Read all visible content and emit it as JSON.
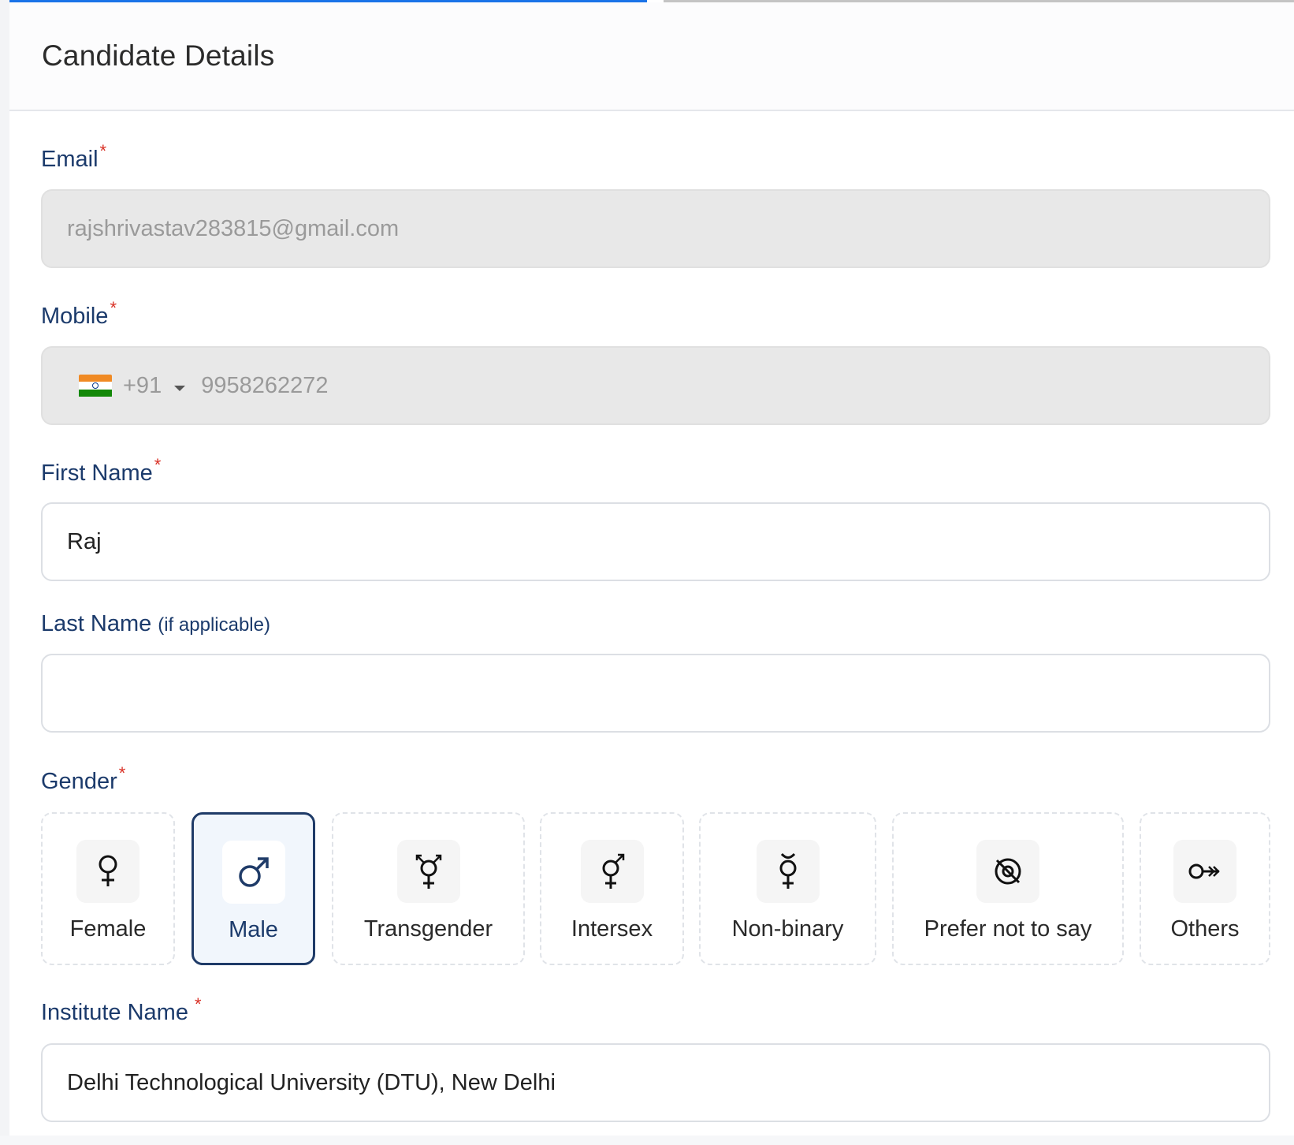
{
  "page": {
    "title": "Candidate Details"
  },
  "fields": {
    "email": {
      "label": "Email",
      "required": "*",
      "value": "rajshrivastav283815@gmail.com"
    },
    "mobile": {
      "label": "Mobile",
      "required": "*",
      "country_code": "+91",
      "flag": "india-flag",
      "value": "9958262272"
    },
    "first_name": {
      "label": "First Name",
      "required": "*",
      "value": "Raj"
    },
    "last_name": {
      "label": "Last Name",
      "hint": "(if applicable)",
      "value": ""
    },
    "gender": {
      "label": "Gender",
      "required": "*",
      "selected": "Male",
      "options": [
        {
          "label": "Female",
          "icon": "female-icon"
        },
        {
          "label": "Male",
          "icon": "male-icon"
        },
        {
          "label": "Transgender",
          "icon": "transgender-icon"
        },
        {
          "label": "Intersex",
          "icon": "intersex-icon"
        },
        {
          "label": "Non-binary",
          "icon": "non-binary-icon"
        },
        {
          "label": "Prefer not to say",
          "icon": "prefer-not-to-say-icon"
        },
        {
          "label": "Others",
          "icon": "others-icon"
        }
      ]
    },
    "institute": {
      "label": "Institute Name",
      "required": "*",
      "value": "Delhi Technological University (DTU), New Delhi"
    }
  },
  "colors": {
    "label": "#1b3a6b",
    "required": "#d93025",
    "progress_active": "#1a73e8",
    "selected_border": "#1f3b68"
  }
}
